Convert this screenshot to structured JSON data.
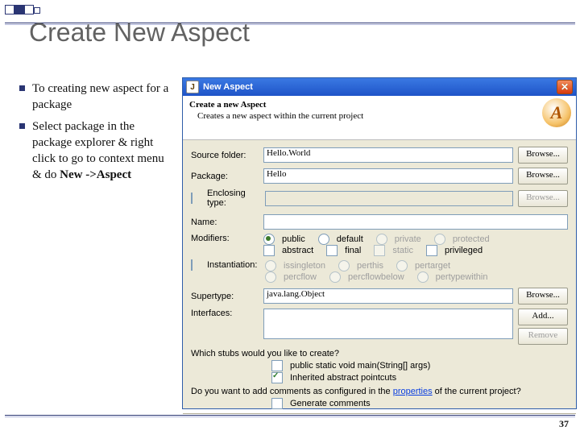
{
  "slide": {
    "title": "Create New Aspect",
    "bullets": [
      "To creating new aspect for a package",
      "Select package in the package explorer & right click to go to context menu & do "
    ],
    "bold_tail": "New ->Aspect",
    "page_number": "37"
  },
  "dialog": {
    "titlebar": {
      "icon": "J",
      "title": "New Aspect"
    },
    "banner": {
      "heading": "Create a new Aspect",
      "sub": "Creates a new aspect within the current project",
      "glyph": "A"
    },
    "labels": {
      "source_folder": "Source folder:",
      "package": "Package:",
      "enclosing": "Enclosing type:",
      "name": "Name:",
      "modifiers": "Modifiers:",
      "instantiation": "Instantiation:",
      "supertype": "Supertype:",
      "interfaces": "Interfaces:"
    },
    "buttons": {
      "browse": "Browse...",
      "add": "Add...",
      "remove": "Remove"
    },
    "fields": {
      "source_folder": "Hello.World",
      "package": "Hello",
      "enclosing": "",
      "name": "",
      "supertype": "java.lang.Object"
    },
    "modifiers": {
      "row1": [
        "public",
        "default",
        "private",
        "protected"
      ],
      "row2": [
        "abstract",
        "final",
        "static",
        "privileged"
      ]
    },
    "instantiation": [
      "issingleton",
      "perthis",
      "pertarget",
      "percflow",
      "percflowbelow",
      "pertypewithin"
    ],
    "stubs": {
      "question": "Which stubs would you like to create?",
      "opt1": "public static void main(String[] args)",
      "opt2": "Inherited abstract pointcuts"
    },
    "comments": {
      "q_pre": "Do you want to add comments as configured in the ",
      "q_link": "properties",
      "q_post": " of the current project?",
      "opt": "Generate comments"
    }
  }
}
